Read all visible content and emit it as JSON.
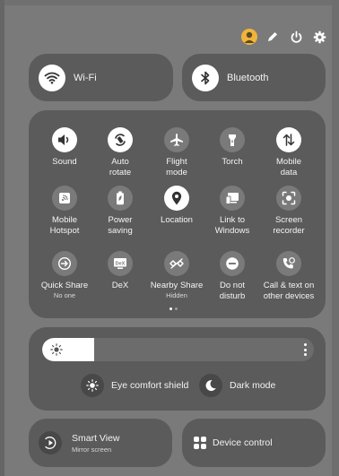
{
  "colors": {
    "background": "#7a7a7a",
    "panel": "#5b5b5b",
    "tile_on": "#ffffff",
    "tile_off": "#7a7a7a",
    "avatar": "#f0b43c"
  },
  "top_bar": {
    "icons": [
      "avatar-icon",
      "edit-pencil-icon",
      "power-icon",
      "settings-gear-icon"
    ]
  },
  "connectivity": {
    "wifi": {
      "label": "Wi-Fi",
      "icon": "wifi-icon",
      "active": true
    },
    "bluetooth": {
      "label": "Bluetooth",
      "icon": "bluetooth-icon",
      "active": true
    }
  },
  "quick_settings": {
    "page_indicator": {
      "pages": 2,
      "current": 1
    },
    "tiles": [
      {
        "label": "Sound",
        "sub": "",
        "icon": "sound-icon",
        "active": true
      },
      {
        "label": "Auto\nrotate",
        "sub": "",
        "icon": "auto-rotate-icon",
        "active": true
      },
      {
        "label": "Flight\nmode",
        "sub": "",
        "icon": "airplane-icon",
        "active": false
      },
      {
        "label": "Torch",
        "sub": "",
        "icon": "torch-icon",
        "active": false
      },
      {
        "label": "Mobile\ndata",
        "sub": "",
        "icon": "mobile-data-icon",
        "active": true
      },
      {
        "label": "Mobile\nHotspot",
        "sub": "",
        "icon": "hotspot-icon",
        "active": false
      },
      {
        "label": "Power\nsaving",
        "sub": "",
        "icon": "power-saving-icon",
        "active": false
      },
      {
        "label": "Location",
        "sub": "",
        "icon": "location-icon",
        "active": true
      },
      {
        "label": "Link to\nWindows",
        "sub": "",
        "icon": "link-to-windows-icon",
        "active": false
      },
      {
        "label": "Screen\nrecorder",
        "sub": "",
        "icon": "screen-recorder-icon",
        "active": false
      },
      {
        "label": "Quick Share",
        "sub": "No one",
        "icon": "quick-share-icon",
        "active": false
      },
      {
        "label": "DeX",
        "sub": "",
        "icon": "dex-icon",
        "active": false
      },
      {
        "label": "Nearby Share",
        "sub": "Hidden",
        "icon": "nearby-share-icon",
        "active": false
      },
      {
        "label": "Do not\ndisturb",
        "sub": "",
        "icon": "do-not-disturb-icon",
        "active": false
      },
      {
        "label": "Call & text on\nother devices",
        "sub": "",
        "icon": "call-text-icon",
        "active": false
      }
    ]
  },
  "brightness": {
    "level": 0.19,
    "icon": "brightness-sun-icon",
    "more_icon": "more-options-icon",
    "eye_comfort_label": "Eye comfort shield",
    "dark_mode_label": "Dark mode"
  },
  "bottom": {
    "smart_view": {
      "title": "Smart View",
      "sub": "Mirror screen",
      "icon": "smart-view-icon"
    },
    "device_control": {
      "label": "Device control",
      "icon": "device-control-icon"
    }
  }
}
